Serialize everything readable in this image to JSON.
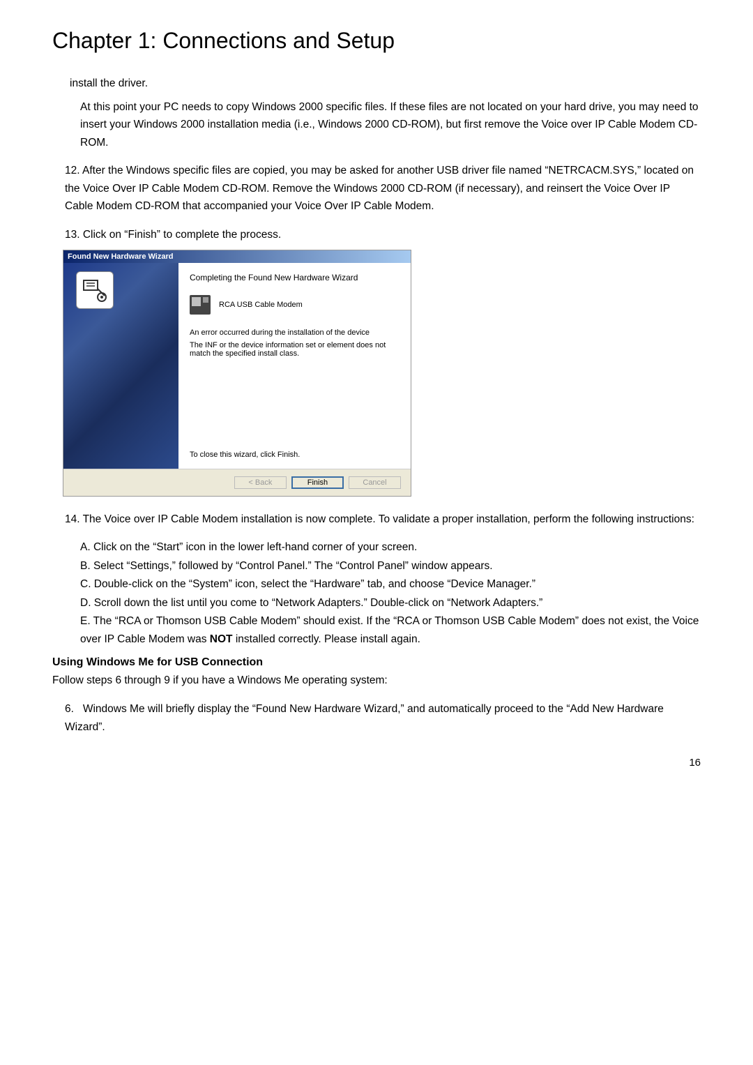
{
  "chapter_title": "Chapter 1: Connections and Setup",
  "intro_line": "install the driver.",
  "para1": "At this point your PC needs to copy Windows 2000 specific files. If these files are not located on your hard drive, you may need to insert your Windows 2000 installation media (i.e., Windows 2000 CD-ROM), but first remove the Voice over IP Cable Modem CD-ROM.",
  "item12": "12. After the Windows specific files are copied, you may be asked for another USB driver file named “NETRCACM.SYS,” located on the Voice Over IP Cable Modem CD-ROM. Remove the Windows 2000 CD-ROM (if necessary), and reinsert the Voice Over IP Cable Modem CD-ROM that accompanied your Voice Over IP Cable Modem.",
  "item13": "13. Click on “Finish” to complete the process.",
  "wizard": {
    "title": "Found New Hardware Wizard",
    "heading": "Completing the Found New Hardware Wizard",
    "device": "RCA USB Cable Modem",
    "error_line": "An error occurred during the installation of the device",
    "inf_line": "The INF or the device information set or element does not match the specified install class.",
    "close_text": "To close this wizard, click Finish.",
    "back": "< Back",
    "finish": "Finish",
    "cancel": "Cancel"
  },
  "item14_lead": "14. The Voice over IP Cable Modem installation is now complete. To validate a proper installation, perform the following instructions:",
  "item14": {
    "a": "A. Click on the “Start” icon in the lower left-hand corner of your screen.",
    "b": "B. Select “Settings,” followed by “Control Panel.” The “Control Panel” window appears.",
    "c": "C. Double-click on the “System” icon, select the “Hardware” tab, and choose “Device Manager.”",
    "d": "D. Scroll down the list until you come to “Network Adapters.” Double-click on “Network Adapters.”",
    "e_pre": "E. The “RCA or Thomson USB Cable Modem” should exist. If the “RCA or Thomson USB Cable Modem” does not exist, the Voice over IP Cable Modem was ",
    "e_bold": "NOT",
    "e_post": " installed correctly. Please install again."
  },
  "section_heading": "Using Windows Me for USB Connection",
  "section_intro": "Follow steps 6 through 9 if you have a Windows Me operating system:",
  "item6": "6.   Windows Me will briefly display the “Found New Hardware Wizard,” and automatically proceed to the “Add New Hardware Wizard”.",
  "page_number": "16"
}
